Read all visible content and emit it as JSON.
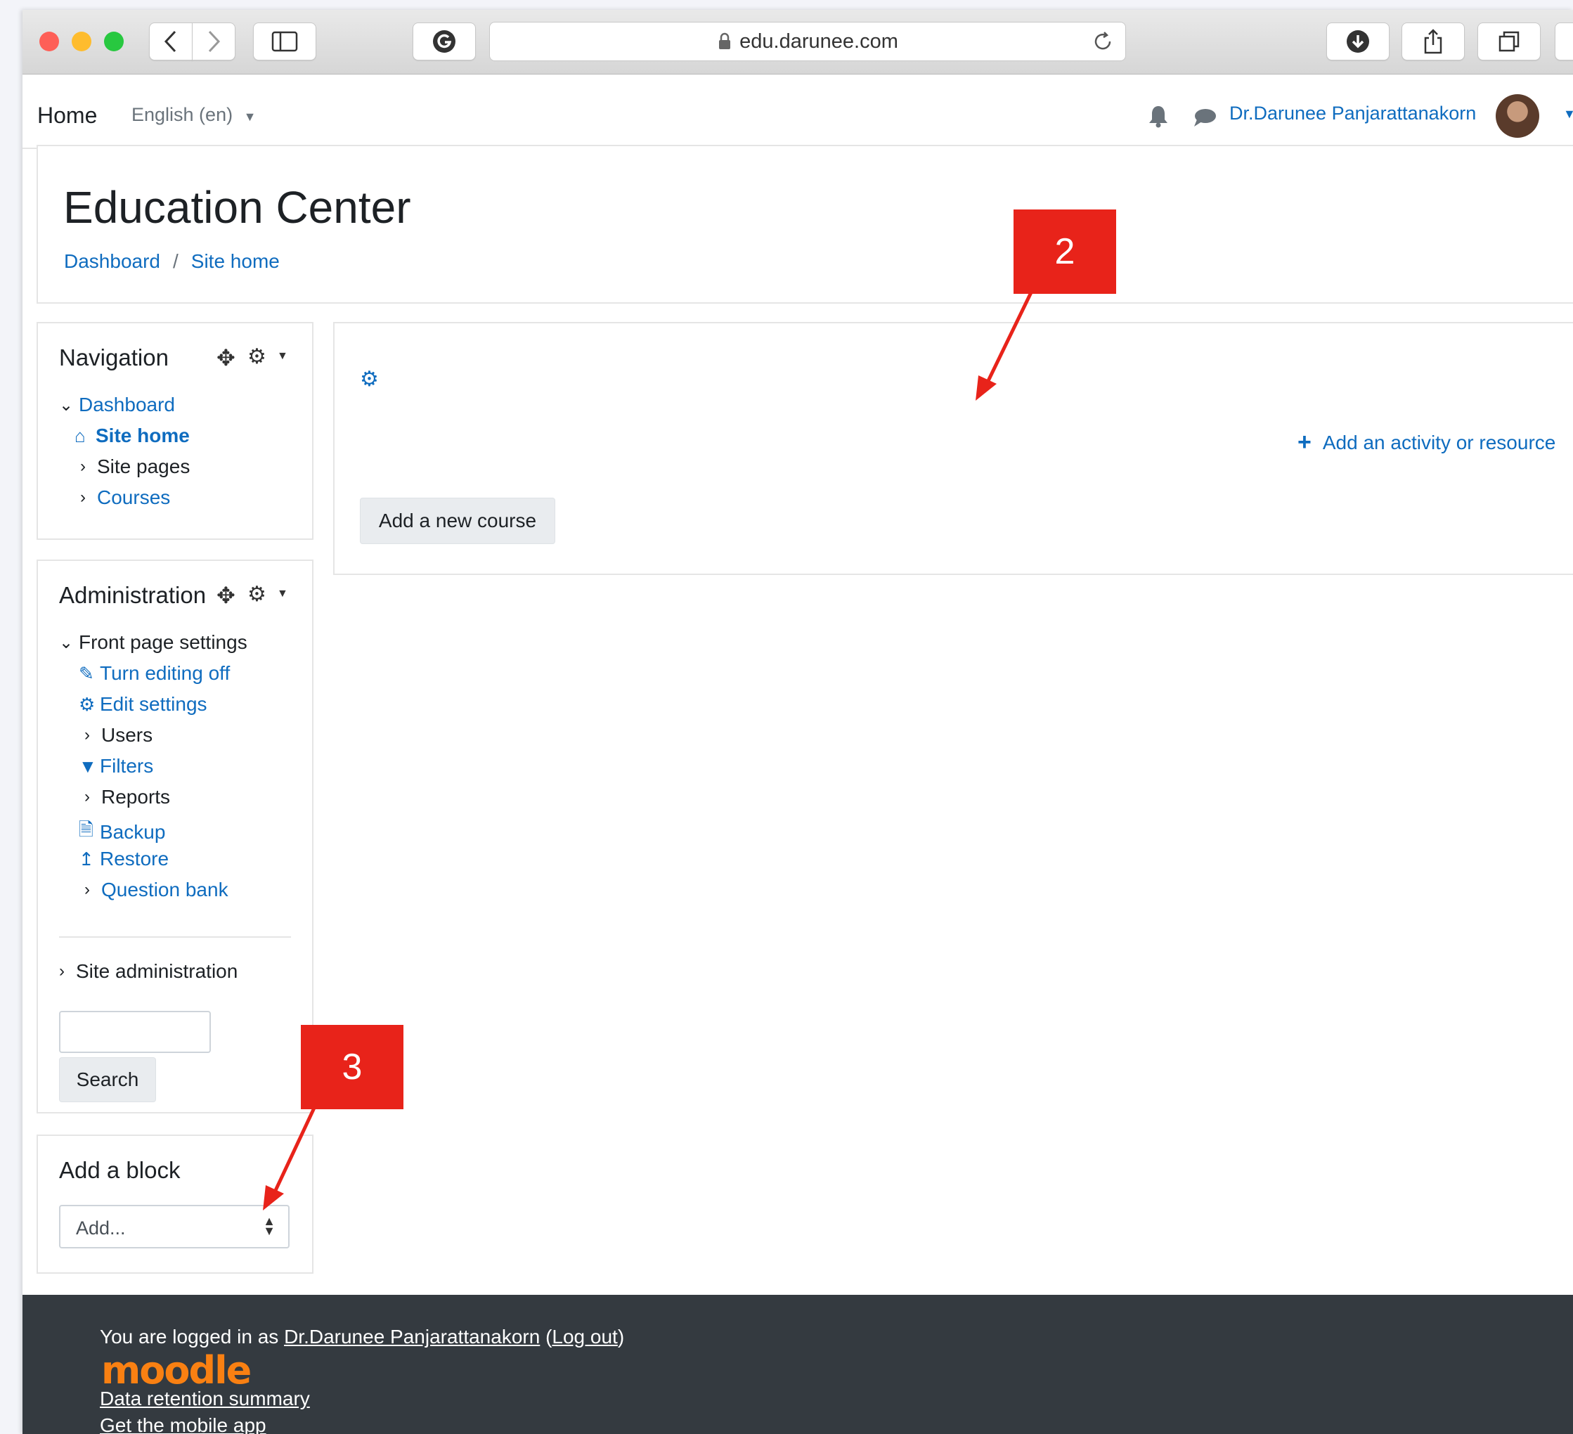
{
  "browser": {
    "url": "edu.darunee.com",
    "colors": {
      "close": "#fe5f57",
      "minimize": "#febc2e",
      "maximize": "#28c840"
    }
  },
  "topnav": {
    "home": "Home",
    "language": "English (en)",
    "user_name": "Dr.Darunee Panjarattanakorn"
  },
  "header": {
    "title": "Education Center",
    "breadcrumb": [
      "Dashboard",
      "/",
      "Site home"
    ]
  },
  "navigation": {
    "title": "Navigation",
    "items": [
      "Dashboard",
      "Site home",
      "Site pages",
      "Courses"
    ]
  },
  "administration": {
    "title": "Administration",
    "items": [
      "Front page settings",
      "Turn editing off",
      "Edit settings",
      "Users",
      "Filters",
      "Reports",
      "Backup",
      "Restore",
      "Question bank"
    ],
    "site_admin": "Site administration",
    "search_value": "",
    "search_button": "Search"
  },
  "add_block": {
    "title": "Add a block",
    "select_value": "Add..."
  },
  "main": {
    "add_activity": "Add an activity or resource",
    "add_course": "Add a new course"
  },
  "footer": {
    "logged_in_prefix": "You are logged in as",
    "user_name": "Dr.Darunee Panjarattanakorn",
    "logout_open": "(",
    "logout": "Log out",
    "logout_close": ")",
    "logo": "moodle",
    "data_retention": "Data retention summary",
    "mobile_app": "Get the mobile app"
  },
  "annotations": [
    "2",
    "3"
  ]
}
